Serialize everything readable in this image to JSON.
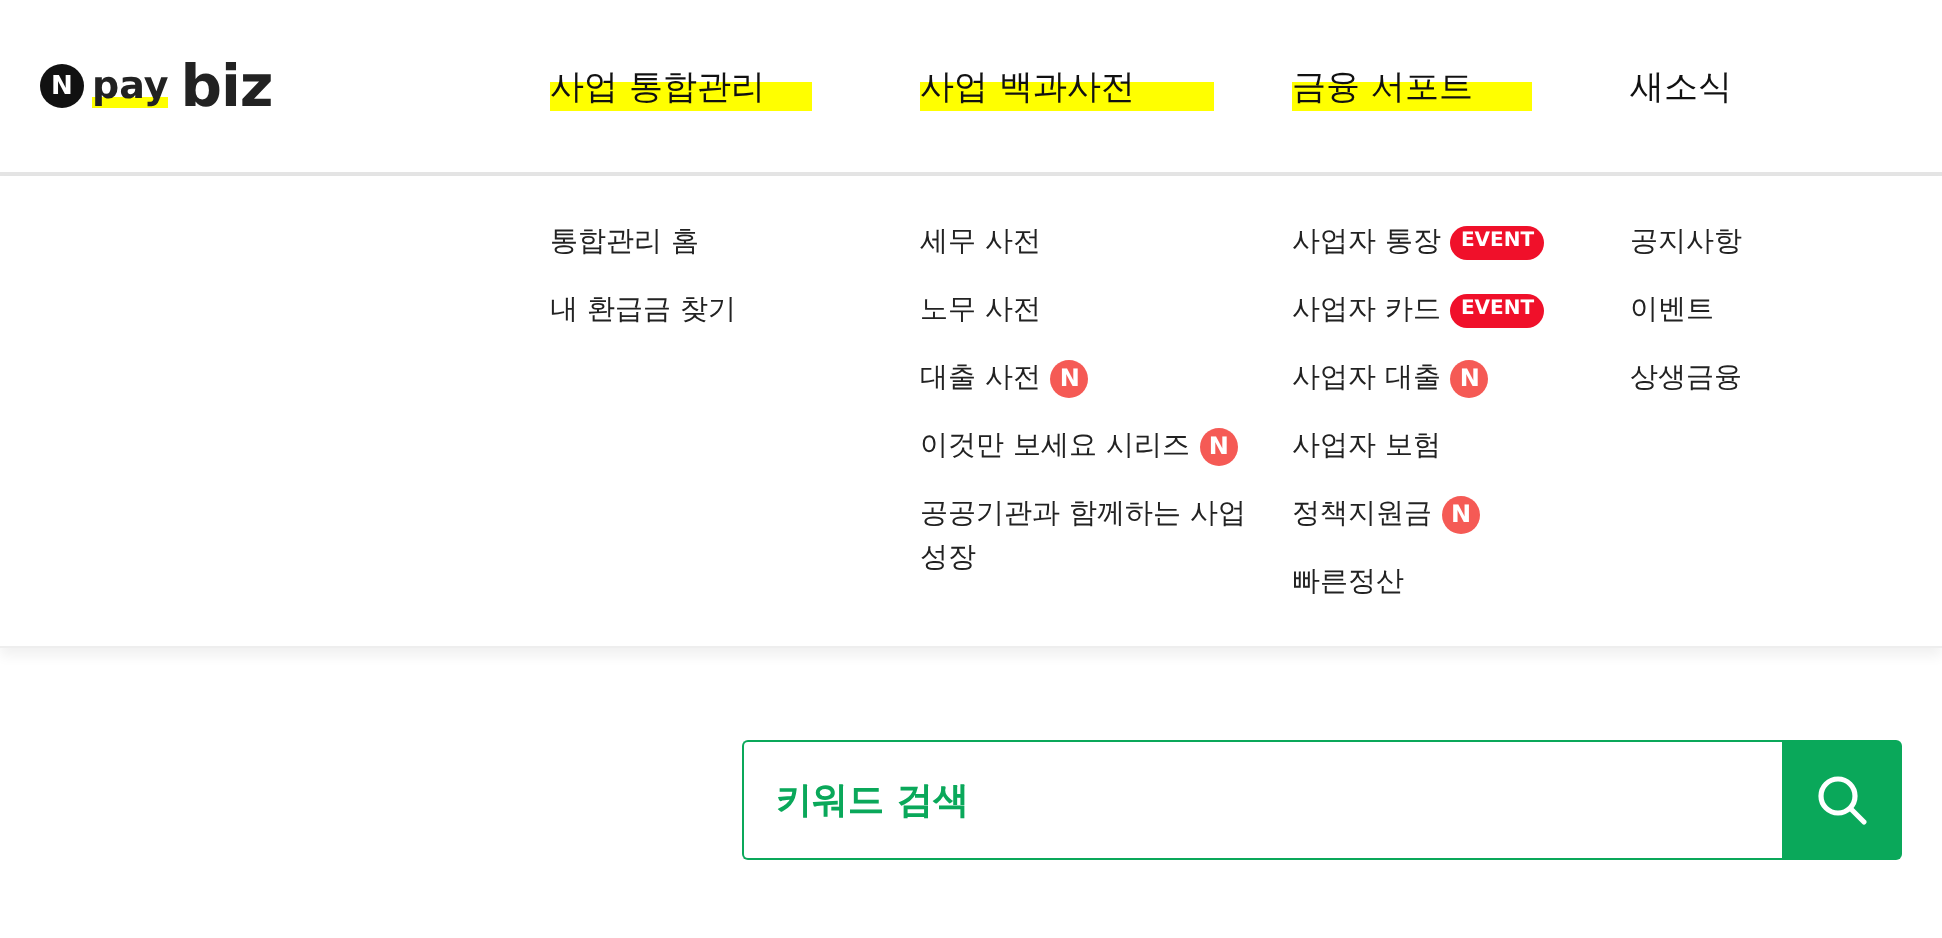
{
  "logo": {
    "mark": "N",
    "word_1": "pay",
    "word_2": "biz",
    "highlighted": true
  },
  "nav": [
    {
      "label": "사업 통합관리",
      "highlighted": true
    },
    {
      "label": "사업 백과사전",
      "highlighted": true
    },
    {
      "label": "금융 서포트",
      "highlighted": true
    },
    {
      "label": "새소식",
      "highlighted": false
    }
  ],
  "submenu": [
    [
      {
        "label": "통합관리 홈"
      },
      {
        "label": "내 환급금 찾기"
      }
    ],
    [
      {
        "label": "세무 사전"
      },
      {
        "label": "노무 사전"
      },
      {
        "label": "대출 사전",
        "badge": {
          "kind": "new",
          "text": "N"
        }
      },
      {
        "label": "이것만 보세요 시리즈",
        "badge": {
          "kind": "new",
          "text": "N"
        }
      },
      {
        "label": "공공기관과 함께하는 사업 성장"
      }
    ],
    [
      {
        "label": "사업자 통장",
        "badge": {
          "kind": "event",
          "text": "EVENT"
        }
      },
      {
        "label": "사업자 카드",
        "badge": {
          "kind": "event",
          "text": "EVENT"
        }
      },
      {
        "label": "사업자 대출",
        "badge": {
          "kind": "new",
          "text": "N"
        }
      },
      {
        "label": "사업자 보험"
      },
      {
        "label": "정책지원금",
        "badge": {
          "kind": "new",
          "text": "N"
        }
      },
      {
        "label": "빠른정산"
      }
    ],
    [
      {
        "label": "공지사항"
      },
      {
        "label": "이벤트"
      },
      {
        "label": "상생금융"
      }
    ]
  ],
  "search": {
    "placeholder": "키워드 검색"
  }
}
